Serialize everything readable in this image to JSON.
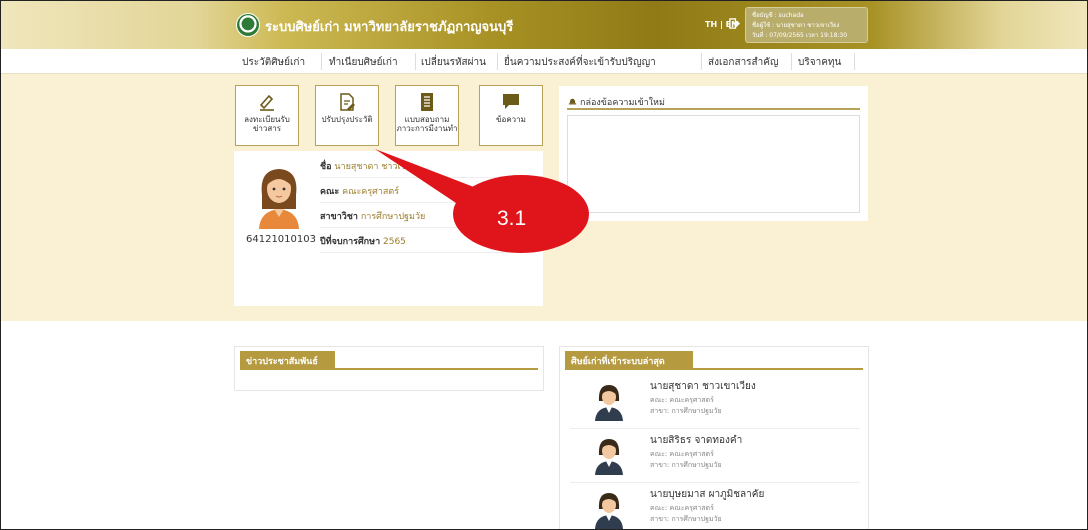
{
  "header": {
    "title": "ระบบศิษย์เก่า มหาวิทยาลัยราชภัฏกาญจนบุรี",
    "lang": "TH | EN",
    "user": {
      "account": "ชื่อบัญชี : suchada",
      "name": "ชื่อผู้ใช้ : นายสุชาดา ชาวเขาเวียง",
      "date": "วันที่ : 07/09/2565 เวลา 19:18:30"
    }
  },
  "menu": [
    "ประวัติศิษย์เก่า",
    "ทำเนียบศิษย์เก่า",
    "เปลี่ยนรหัสผ่าน",
    "ยื่นความประสงค์ที่จะเข้ารับปริญญา",
    "ส่งเอกสารสำคัญ",
    "บริจาคทุน"
  ],
  "tiles": [
    {
      "label": "ลงทะเบียนรับข่าวสาร",
      "icon": "pen-register-icon"
    },
    {
      "label": "ปรับปรุงประวัติ",
      "icon": "document-edit-icon"
    },
    {
      "label": "แบบสอบถามภาวะการมีงานทำ",
      "icon": "survey-list-icon"
    },
    {
      "label": "ข้อความ",
      "icon": "message-icon"
    }
  ],
  "profile": {
    "student_id": "64121010103",
    "name_label": "ชื่อ",
    "name": "นายสุชาดา ชาวเข",
    "faculty_label": "คณะ",
    "faculty": "คณะครุศาสตร์",
    "major_label": "สาขาวิชา",
    "major": "การศึกษาปฐมวัย",
    "grad_label": "ปีที่จบการศึกษา",
    "grad_year": "2565"
  },
  "inbox": {
    "title": "กล่องข้อความเข้าใหม่",
    "icon": "bell-icon"
  },
  "callout": {
    "label": "3.1",
    "color": "#e0151b"
  },
  "news": {
    "title": "ข่าวประชาสัมพันธ์"
  },
  "recent": {
    "title": "ศิษย์เก่าที่เข้าระบบล่าสุด",
    "people": [
      {
        "name": "นายสุชาดา ชาวเขาเวียง",
        "faculty": "คณะ: คณะครุศาสตร์",
        "major": "สาขา: การศึกษาปฐมวัย"
      },
      {
        "name": "นายสิริธร จาดทองคำ",
        "faculty": "คณะ: คณะครุศาสตร์",
        "major": "สาขา: การศึกษาปฐมวัย"
      },
      {
        "name": "นายบุษยมาส ผาภูมิชลาคัย",
        "faculty": "คณะ: คณะครุศาสตร์",
        "major": "สาขา: การศึกษาปฐมวัย"
      }
    ]
  },
  "colors": {
    "gold": "#b59a40",
    "band": "#faf0d4",
    "header_dark": "#8f7a16"
  }
}
